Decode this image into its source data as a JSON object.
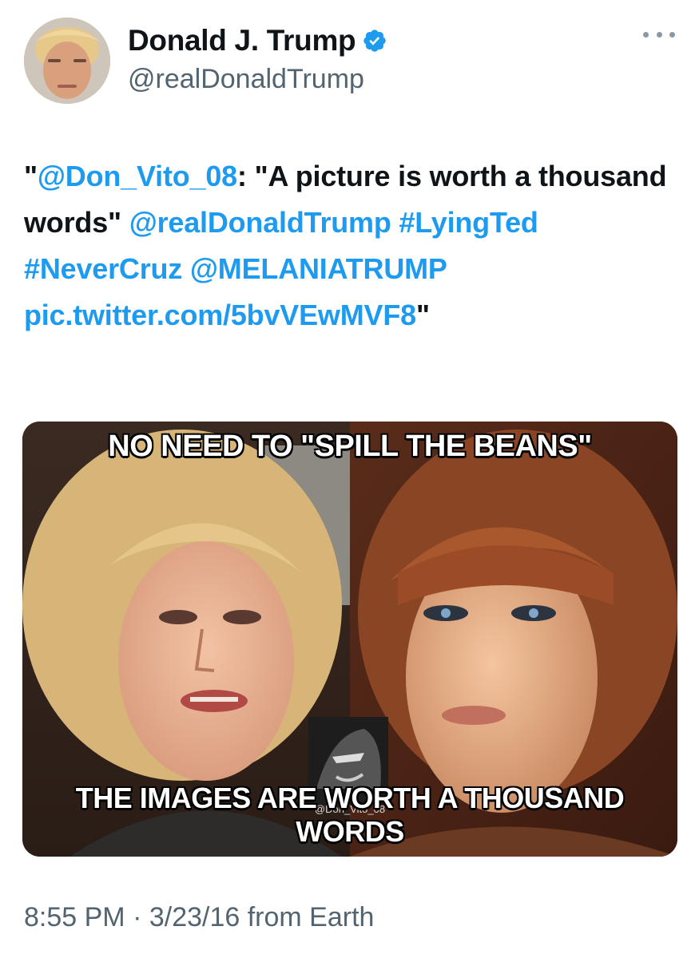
{
  "user": {
    "display_name": "Donald J. Trump",
    "handle": "@realDonaldTrump",
    "verified": true,
    "avatar_icon": "profile-photo",
    "verified_icon": "verified-badge-icon"
  },
  "tweet": {
    "segments": [
      {
        "text": "\"",
        "type": "text"
      },
      {
        "text": "@Don_Vito_08",
        "type": "link"
      },
      {
        "text": ": \"A picture is worth a thousand words\" ",
        "type": "text"
      },
      {
        "text": "@realDonaldTrump",
        "type": "link"
      },
      {
        "text": " ",
        "type": "text"
      },
      {
        "text": "#LyingTed",
        "type": "link"
      },
      {
        "text": " ",
        "type": "text"
      },
      {
        "text": "#NeverCruz",
        "type": "link"
      },
      {
        "text": " ",
        "type": "text"
      },
      {
        "text": "@MELANIATRUMP",
        "type": "link"
      },
      {
        "text": " ",
        "type": "text"
      },
      {
        "text": "pic.twitter.com/5bvVEwMVF8",
        "type": "link"
      },
      {
        "text": "\"",
        "type": "text"
      }
    ]
  },
  "media": {
    "top_caption": "NO NEED TO \"SPILL THE BEANS\"",
    "bottom_caption": "THE IMAGES ARE WORTH A THOUSAND WORDS",
    "watermark": "@Don_Vito_08"
  },
  "timestamp": "8:55 PM · 3/23/16 from Earth",
  "colors": {
    "link": "#1d9bf0",
    "text": "#0f1419",
    "secondary": "#536471"
  }
}
